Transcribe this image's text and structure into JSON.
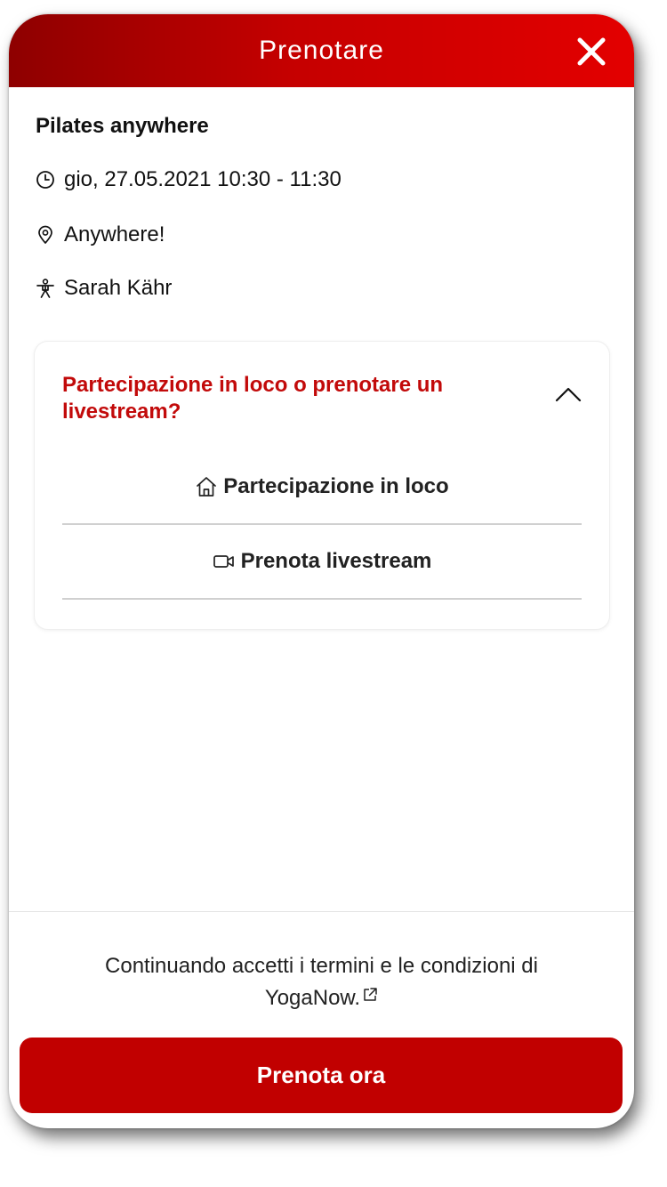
{
  "header": {
    "title": "Prenotare",
    "close_icon": "close-icon"
  },
  "class_info": {
    "title": "Pilates anywhere",
    "datetime": "gio, 27.05.2021 10:30 - 11:30",
    "location": "Anywhere!",
    "teacher": "Sarah Kähr",
    "icons": [
      "clock-icon",
      "location-pin-icon",
      "person-icon"
    ]
  },
  "options_card": {
    "question": "Partecipazione in loco o prenotare un livestream?",
    "expanded": true,
    "options": [
      {
        "label": "Partecipazione in loco",
        "icon": "home-icon"
      },
      {
        "label": "Prenota livestream",
        "icon": "video-camera-icon"
      }
    ]
  },
  "footer": {
    "terms_text": "Continuando accetti i termini e le condizioni di",
    "terms_link": "YogaNow.",
    "book_button": "Prenota ora"
  },
  "colors": {
    "accent": "#c10000",
    "header_gradient_start": "#8e0000",
    "header_gradient_end": "#e30000",
    "question_text": "#c20a0a"
  }
}
